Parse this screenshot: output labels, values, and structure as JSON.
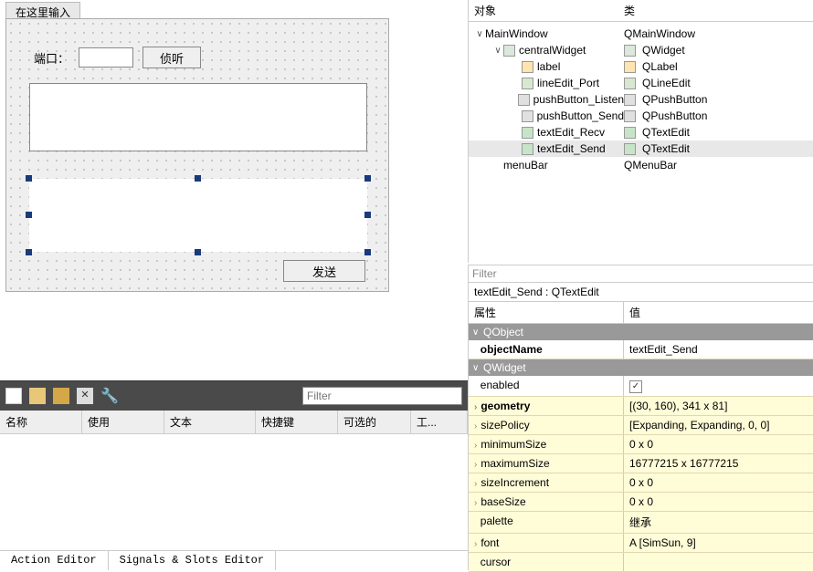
{
  "form": {
    "tab_label": "在这里输入",
    "port_label": "端口：",
    "listen_button": "侦听",
    "send_button": "发送"
  },
  "object_tree": {
    "header_object": "对象",
    "header_class": "类",
    "rows": [
      {
        "indent": 0,
        "expander": "∨",
        "name": "MainWindow",
        "class": "QMainWindow",
        "icon": ""
      },
      {
        "indent": 1,
        "expander": "∨",
        "name": "centralWidget",
        "class": "QWidget",
        "icon": "widget"
      },
      {
        "indent": 2,
        "expander": "",
        "name": "label",
        "class": "QLabel",
        "icon": "label"
      },
      {
        "indent": 2,
        "expander": "",
        "name": "lineEdit_Port",
        "class": "QLineEdit",
        "icon": "line"
      },
      {
        "indent": 2,
        "expander": "",
        "name": "pushButton_Listen",
        "class": "QPushButton",
        "icon": "push"
      },
      {
        "indent": 2,
        "expander": "",
        "name": "pushButton_Send",
        "class": "QPushButton",
        "icon": "push"
      },
      {
        "indent": 2,
        "expander": "",
        "name": "textEdit_Recv",
        "class": "QTextEdit",
        "icon": "text"
      },
      {
        "indent": 2,
        "expander": "",
        "name": "textEdit_Send",
        "class": "QTextEdit",
        "icon": "text",
        "selected": true
      },
      {
        "indent": 1,
        "expander": "",
        "name": "menuBar",
        "class": "QMenuBar",
        "icon": ""
      }
    ]
  },
  "property_panel": {
    "filter_placeholder": "Filter",
    "title": "textEdit_Send : QTextEdit",
    "header_prop": "属性",
    "header_val": "值",
    "groups": [
      {
        "name": "QObject",
        "rows": [
          {
            "name": "objectName",
            "value": "textEdit_Send",
            "bold": true,
            "yellow": false
          }
        ]
      },
      {
        "name": "QWidget",
        "rows": [
          {
            "name": "enabled",
            "value": "checkbox",
            "yellow": false
          },
          {
            "name": "geometry",
            "value": "[(30, 160), 341 x 81]",
            "bold": true,
            "expandable": true,
            "yellow": true
          },
          {
            "name": "sizePolicy",
            "value": "[Expanding, Expanding, 0, 0]",
            "expandable": true,
            "yellow": true
          },
          {
            "name": "minimumSize",
            "value": "0 x 0",
            "expandable": true,
            "yellow": true
          },
          {
            "name": "maximumSize",
            "value": "16777215 x 16777215",
            "expandable": true,
            "yellow": true
          },
          {
            "name": "sizeIncrement",
            "value": "0 x 0",
            "expandable": true,
            "yellow": true
          },
          {
            "name": "baseSize",
            "value": "0 x 0",
            "expandable": true,
            "yellow": true
          },
          {
            "name": "palette",
            "value": "继承",
            "yellow": true
          },
          {
            "name": "font",
            "value": "A  [SimSun, 9]",
            "expandable": true,
            "yellow": true
          },
          {
            "name": "cursor",
            "value": "",
            "yellow": true
          }
        ]
      }
    ]
  },
  "action_panel": {
    "filter_placeholder": "Filter",
    "headers": [
      "名称",
      "使用",
      "文本",
      "快捷键",
      "可选的",
      "工..."
    ],
    "tabs": [
      "Action Editor",
      "Signals & Slots Editor"
    ]
  }
}
